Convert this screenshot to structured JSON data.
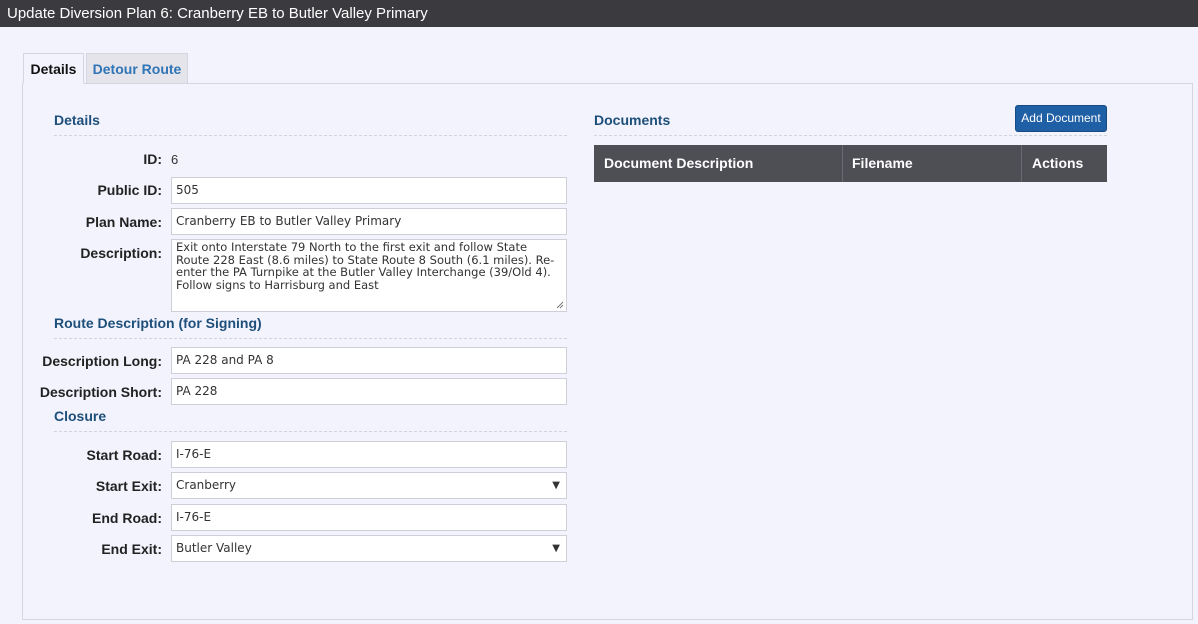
{
  "window": {
    "title": "Update Diversion Plan 6: Cranberry EB to Butler Valley Primary"
  },
  "tabs": [
    {
      "label": "Details",
      "active": true
    },
    {
      "label": "Detour Route",
      "active": false
    }
  ],
  "details": {
    "heading": "Details",
    "id_label": "ID:",
    "id_value": "6",
    "public_id_label": "Public ID:",
    "public_id_value": "505",
    "plan_name_label": "Plan Name:",
    "plan_name_value": "Cranberry EB to Butler Valley Primary",
    "description_label": "Description:",
    "description_value": "Exit onto Interstate 79 North to the first exit and follow State Route 228 East (8.6 miles) to State Route 8 South (6.1 miles).  Re-enter the PA Turnpike at the Butler Valley Interchange (39/Old 4). Follow signs to Harrisburg and East"
  },
  "route_description": {
    "heading": "Route Description (for Signing)",
    "long_label": "Description Long:",
    "long_value": "PA 228 and PA 8",
    "short_label": "Description Short:",
    "short_value": "PA 228"
  },
  "closure": {
    "heading": "Closure",
    "start_road_label": "Start Road:",
    "start_road_value": "I-76-E",
    "start_exit_label": "Start Exit:",
    "start_exit_value": "Cranberry",
    "end_road_label": "End Road:",
    "end_road_value": "I-76-E",
    "end_exit_label": "End Exit:",
    "end_exit_value": "Butler Valley"
  },
  "documents": {
    "heading": "Documents",
    "add_button_label": "Add Document",
    "columns": [
      "Document Description",
      "Filename",
      "Actions"
    ]
  },
  "colors": {
    "titlebar": "#3a3a3f",
    "accent": "#1f5fa5",
    "section_heading": "#1d4f7a",
    "table_header": "#4e4e55"
  }
}
